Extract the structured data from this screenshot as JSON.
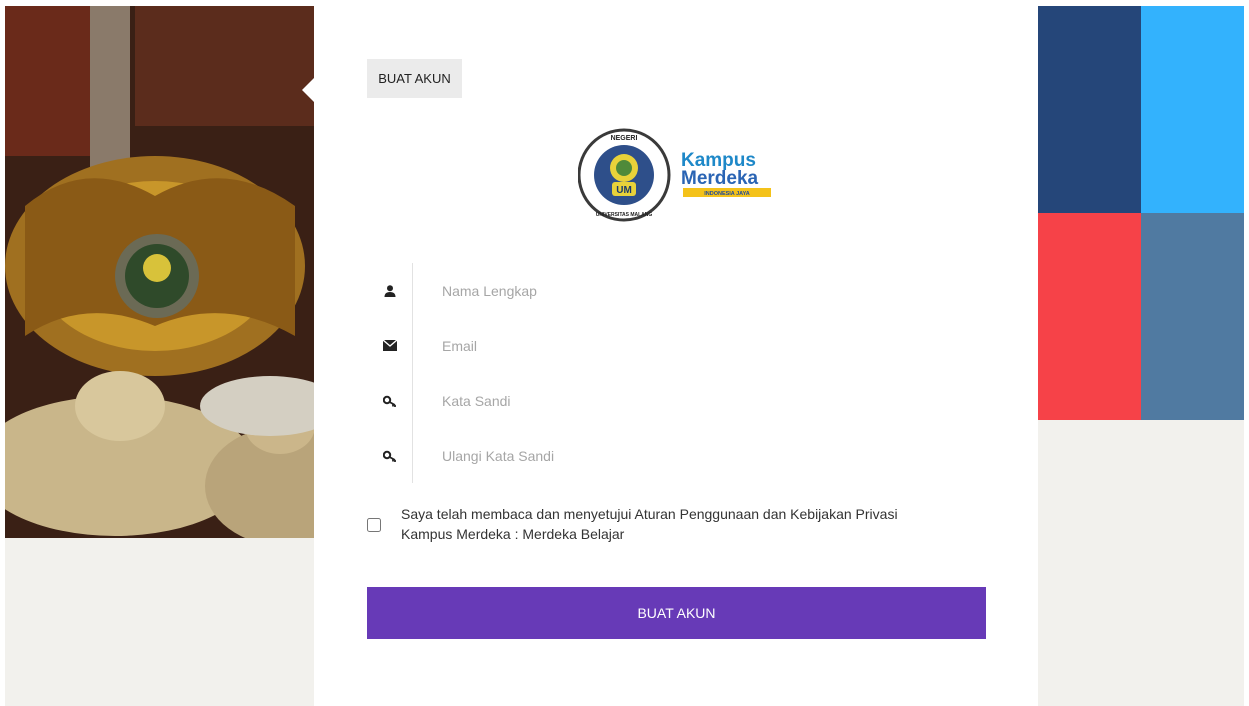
{
  "tab": {
    "label": "BUAT AKUN"
  },
  "logos": {
    "university_ring_top": "NEGERI",
    "university_ring_bottom": "UNIVERSITAS MALANG",
    "university_initials": "UM",
    "kampus_line1": "Kampus",
    "kampus_line2": "Merdeka",
    "kampus_tagline": "INDONESIA JAYA"
  },
  "form": {
    "fields": [
      {
        "icon": "user-icon",
        "placeholder": "Nama Lengkap",
        "value": ""
      },
      {
        "icon": "envelope-icon",
        "placeholder": "Email",
        "value": ""
      },
      {
        "icon": "key-icon",
        "placeholder": "Kata Sandi",
        "value": ""
      },
      {
        "icon": "key-icon",
        "placeholder": "Ulangi Kata Sandi",
        "value": ""
      }
    ],
    "agreement": {
      "line1": "Saya telah membaca dan menyetujui Aturan Penggunaan dan Kebijakan Privasi",
      "line2": "Kampus Merdeka : Merdeka Belajar",
      "checked": false
    },
    "submit_label": "BUAT AKUN"
  },
  "colors": {
    "primary": "#673ab7",
    "tile_navy": "#254679",
    "tile_sky": "#33b2fd",
    "tile_red": "#f64248",
    "tile_steel": "#507aa1",
    "panel_bg": "#f2f1ed"
  }
}
